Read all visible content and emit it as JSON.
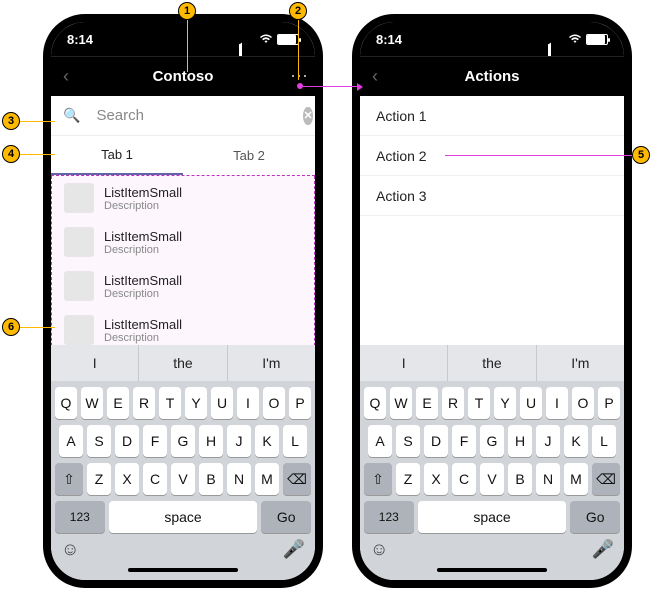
{
  "status": {
    "time": "8:14"
  },
  "phone_left": {
    "title": "Contoso",
    "search": {
      "placeholder": "Search"
    },
    "tabs": [
      "Tab 1",
      "Tab 2"
    ],
    "items": [
      {
        "title": "ListItemSmall",
        "desc": "Description"
      },
      {
        "title": "ListItemSmall",
        "desc": "Description"
      },
      {
        "title": "ListItemSmall",
        "desc": "Description"
      },
      {
        "title": "ListItemSmall",
        "desc": "Description"
      }
    ]
  },
  "phone_right": {
    "title": "Actions",
    "actions": [
      "Action 1",
      "Action 2",
      "Action 3"
    ]
  },
  "keyboard": {
    "suggestions": [
      "I",
      "the",
      "I'm"
    ],
    "row1": [
      "Q",
      "W",
      "E",
      "R",
      "T",
      "Y",
      "U",
      "I",
      "O",
      "P"
    ],
    "row2": [
      "A",
      "S",
      "D",
      "F",
      "G",
      "H",
      "J",
      "K",
      "L"
    ],
    "row3": [
      "Z",
      "X",
      "C",
      "V",
      "B",
      "N",
      "M"
    ],
    "shift": "⇧",
    "bksp": "⌫",
    "numkey": "123",
    "space": "space",
    "go": "Go",
    "emoji": "☺",
    "mic": "🎤"
  },
  "callouts": [
    "1",
    "2",
    "3",
    "4",
    "5",
    "6"
  ]
}
